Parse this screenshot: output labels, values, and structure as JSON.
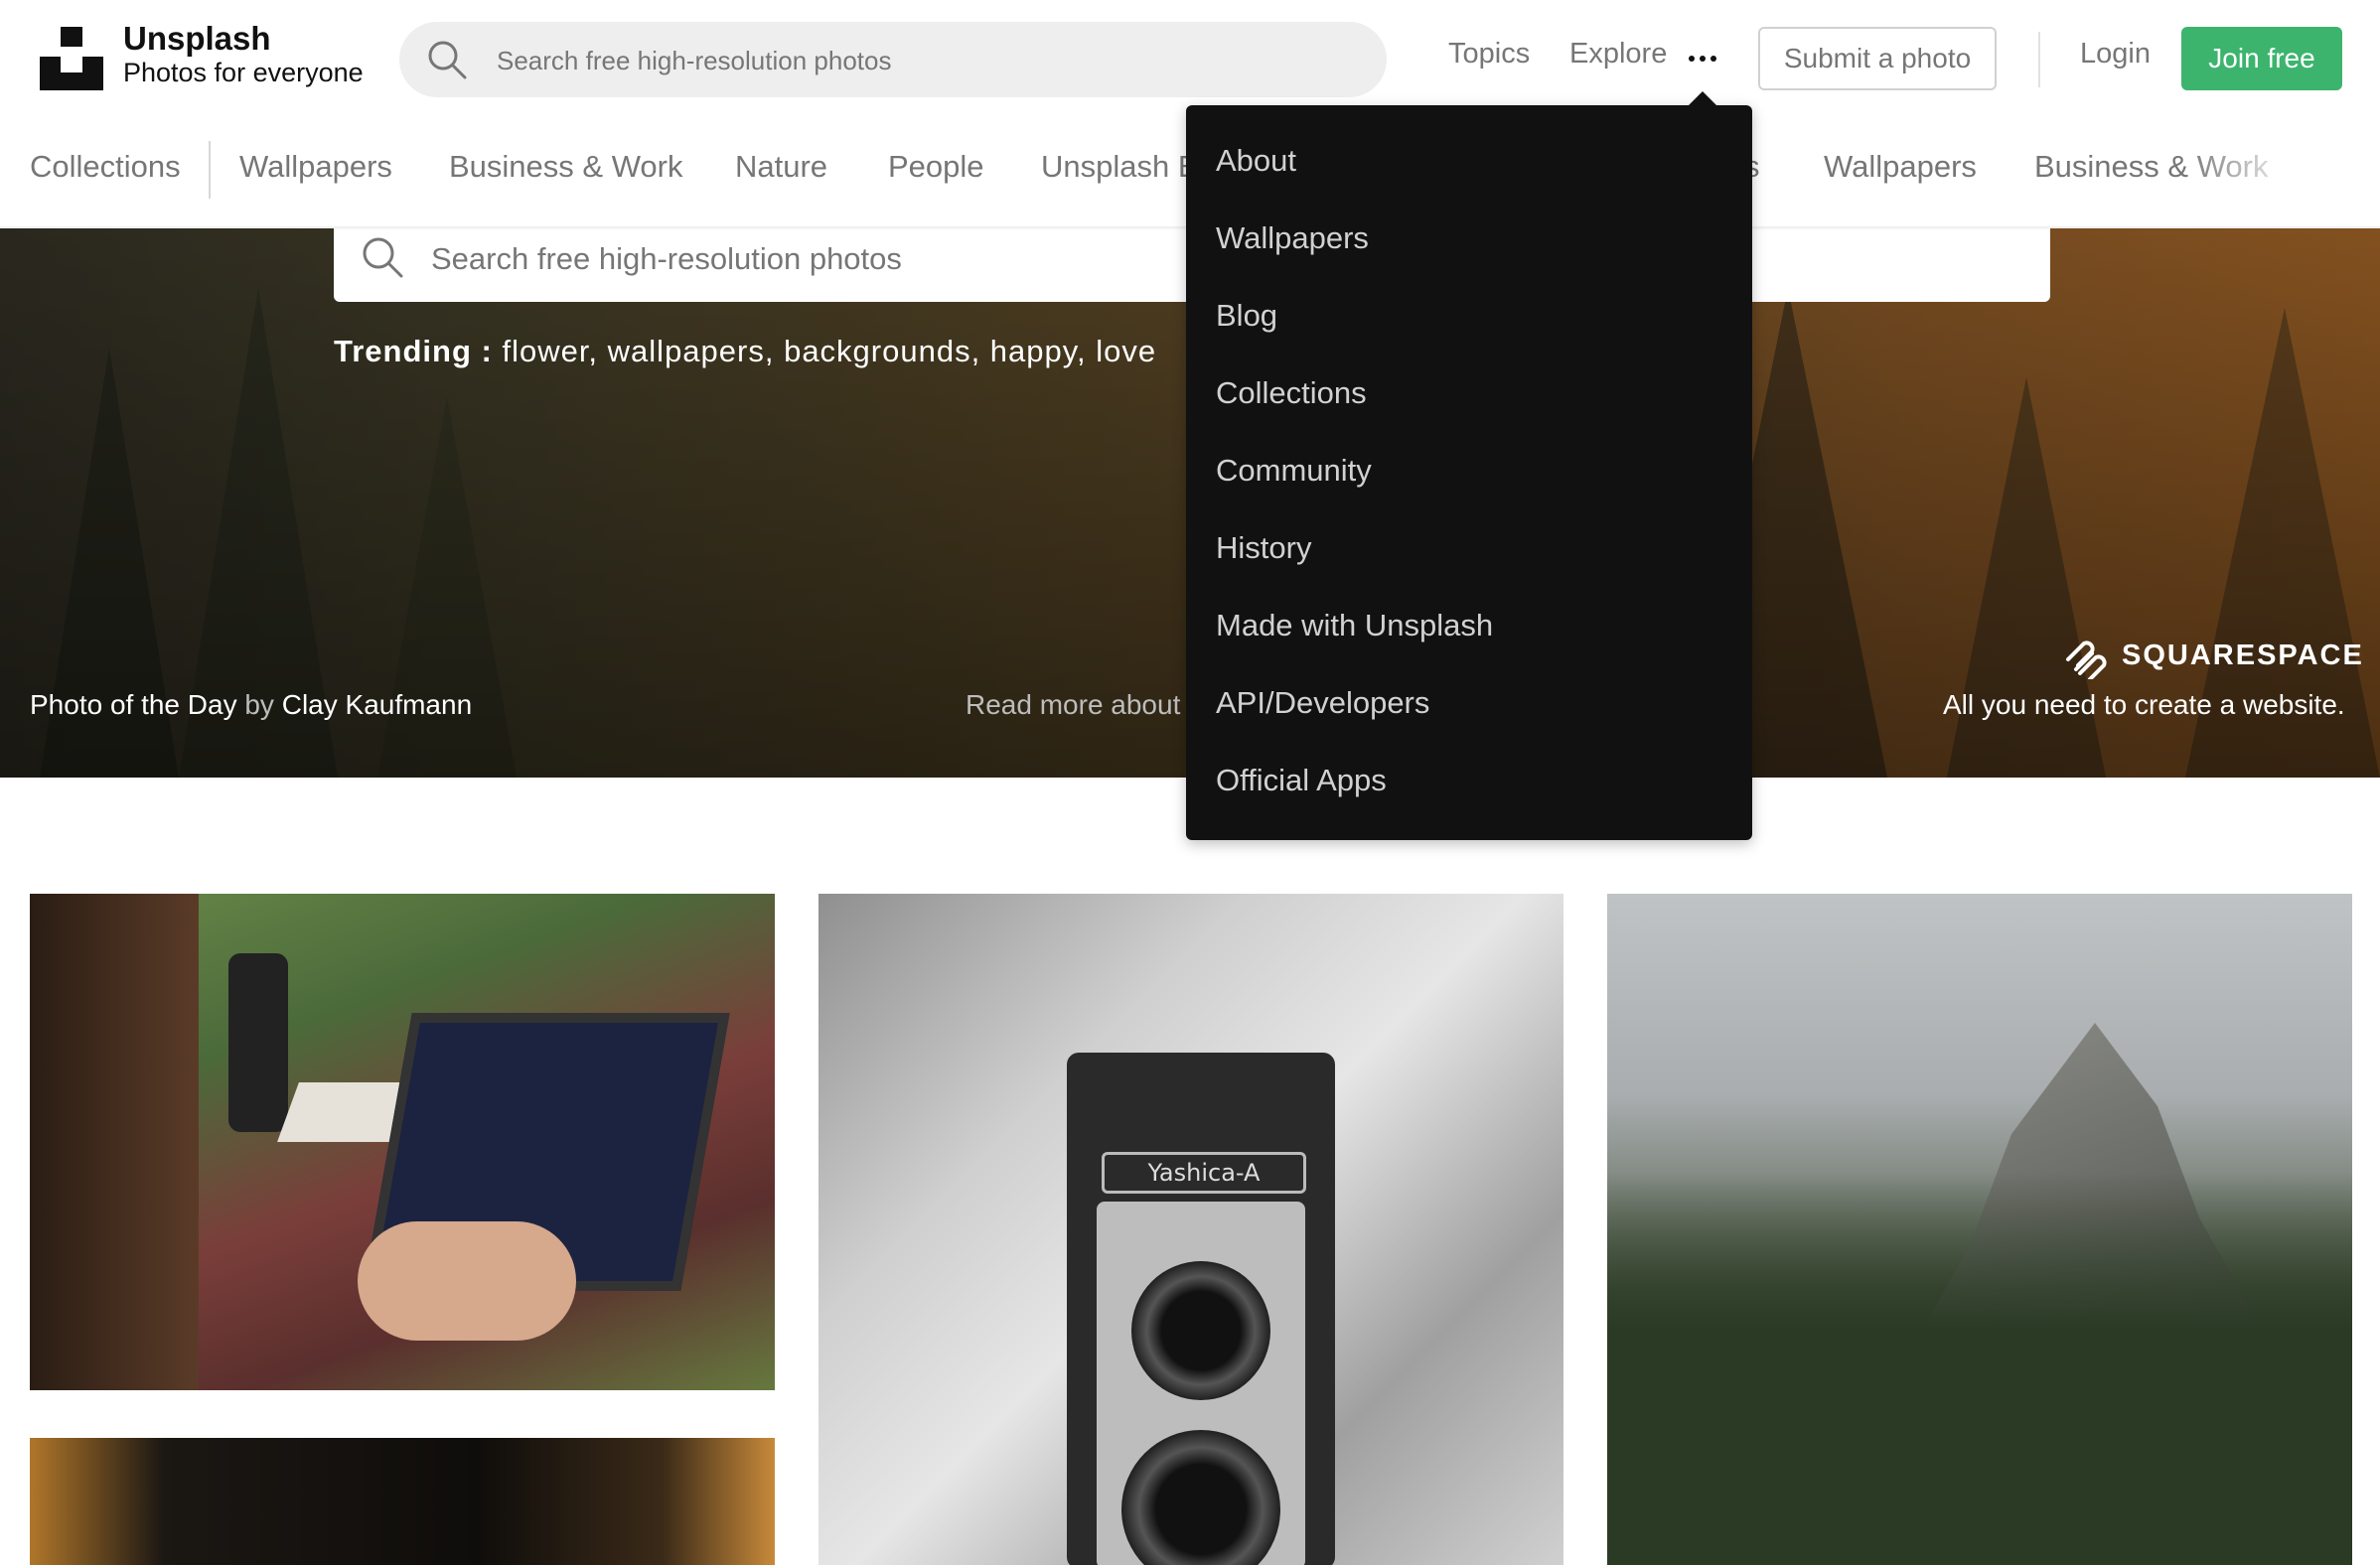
{
  "header": {
    "brand_name": "Unsplash",
    "brand_tagline": "Photos for everyone",
    "search_placeholder": "Search free high-resolution photos",
    "nav": {
      "topics": "Topics",
      "explore": "Explore"
    },
    "submit_label": "Submit a photo",
    "login_label": "Login",
    "join_label": "Join free"
  },
  "topics": [
    "Collections",
    "Wallpapers",
    "Business & Work",
    "Nature",
    "People",
    "Unsplash E",
    "s",
    "Wallpapers",
    "Business & Work"
  ],
  "hero": {
    "search_placeholder": "Search free high-resolution photos",
    "trending_label": "Trending :",
    "trending_terms": "flower, wallpapers, backgrounds, happy, love",
    "potd_label": "Photo of the Day",
    "potd_by": "by",
    "potd_author": "Clay Kaufmann",
    "read_more": "Read more about",
    "sponsor_name": "SQUARESPACE",
    "sponsor_tagline": "All you need to create a website."
  },
  "dropdown": {
    "items": [
      "About",
      "Wallpapers",
      "Blog",
      "Collections",
      "Community",
      "History",
      "Made with Unsplash",
      "API/Developers",
      "Official Apps"
    ]
  },
  "photos": {
    "camera_plate": "Yashica-A"
  },
  "colors": {
    "accent_green": "#3cb46e",
    "dropdown_bg": "#111111",
    "muted_text": "#767676"
  },
  "icons": {
    "search": "search-icon",
    "more": "more-dots-icon",
    "logo": "unsplash-logo",
    "sponsor": "squarespace-logo"
  }
}
